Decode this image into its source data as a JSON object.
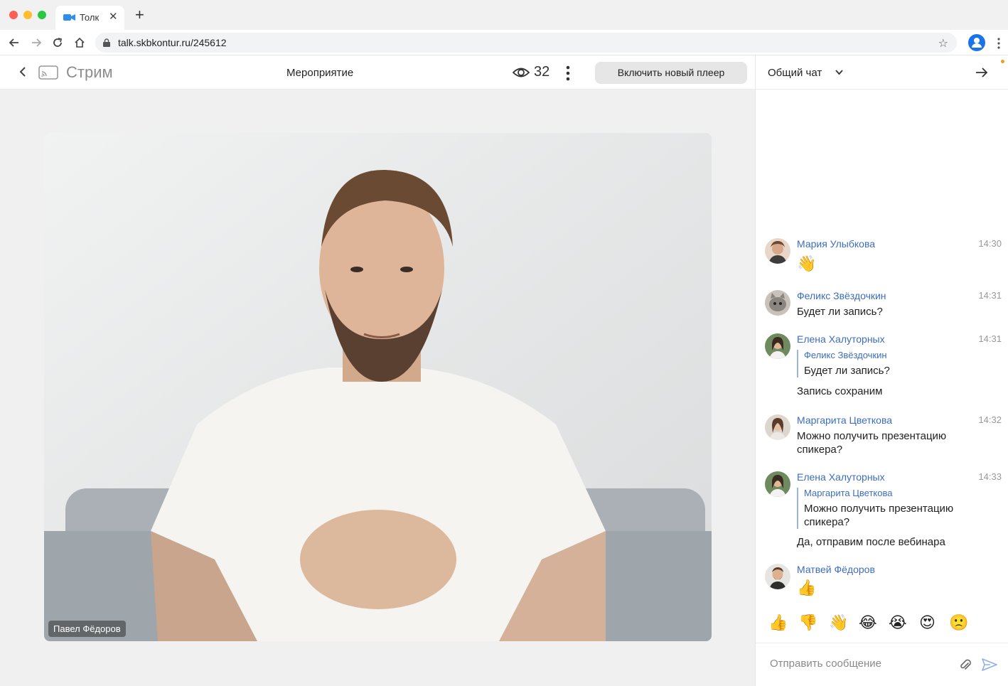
{
  "browser": {
    "tab_title": "Толк",
    "url": "talk.skbkontur.ru/245612"
  },
  "header": {
    "stream_title": "Стрим",
    "event_title": "Мероприятие",
    "viewers": "32",
    "player_button": "Включить новый плеер"
  },
  "video": {
    "speaker_name": "Павел Фёдоров"
  },
  "chat": {
    "title": "Общий чат",
    "messages": [
      {
        "author": "Мария Улыбкова",
        "time": "14:30",
        "emoji": "👋"
      },
      {
        "author": "Феликс Звёздочкин",
        "time": "14:31",
        "text": "Будет ли запись?"
      },
      {
        "author": "Елена Халуторных",
        "time": "14:31",
        "quote_author": "Феликс Звёздочкин",
        "quote_text": "Будет ли запись?",
        "text": "Запись сохраним"
      },
      {
        "author": "Маргарита Цветкова",
        "time": "14:32",
        "text": "Можно получить презентацию спикера?"
      },
      {
        "author": "Елена Халуторных",
        "time": "14:33",
        "quote_author": "Маргарита Цветкова",
        "quote_text": "Можно получить презентацию спикера?",
        "text": "Да, отправим после вебинара"
      },
      {
        "author": "Матвей Фёдоров",
        "time": "",
        "emoji": "👍"
      }
    ],
    "reactions": [
      "👍",
      "👎",
      "👋",
      "😂",
      "😭",
      "😍",
      "🙁"
    ],
    "composer_placeholder": "Отправить сообщение"
  },
  "colors": {
    "accent": "#3d6dbe",
    "button_bg": "#e6e6e6"
  }
}
